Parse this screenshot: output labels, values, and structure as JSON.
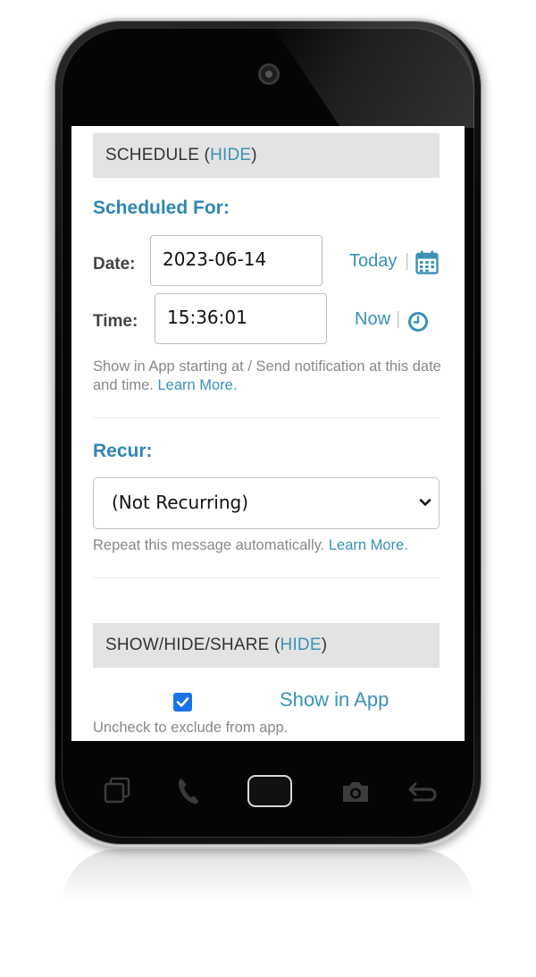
{
  "schedule": {
    "header_text": "SCHEDULE (",
    "header_link": "HIDE",
    "header_close": ")",
    "scheduled_for_label": "Scheduled For:",
    "date_label": "Date:",
    "date_value": "2023-06-14",
    "today_link": "Today",
    "time_label": "Time:",
    "time_value": "15:36:01",
    "now_link": "Now",
    "separator": "|",
    "help_text": "Show in App starting at / Send notification at this date and time.",
    "learn_more": "Learn More."
  },
  "recur": {
    "label": "Recur:",
    "selected": "(Not Recurring)",
    "help_text": "Repeat this message automatically.",
    "learn_more": "Learn More."
  },
  "share": {
    "header_text": "SHOW/HIDE/SHARE (",
    "header_link": "HIDE",
    "header_close": ")",
    "show_in_app_label": "Show in App",
    "show_in_app_checked": true,
    "help_text": "Uncheck to exclude from app."
  },
  "icons": {
    "calendar": "calendar-icon",
    "clock": "clock-icon",
    "recents": "recent-apps-icon",
    "phone": "phone-icon",
    "home": "home-button",
    "camera": "camera-icon",
    "back": "back-icon"
  },
  "colors": {
    "accent": "#2f86b2",
    "link": "#3a91b8",
    "header_bg": "#e3e3e3",
    "checkbox": "#1a73e8"
  }
}
